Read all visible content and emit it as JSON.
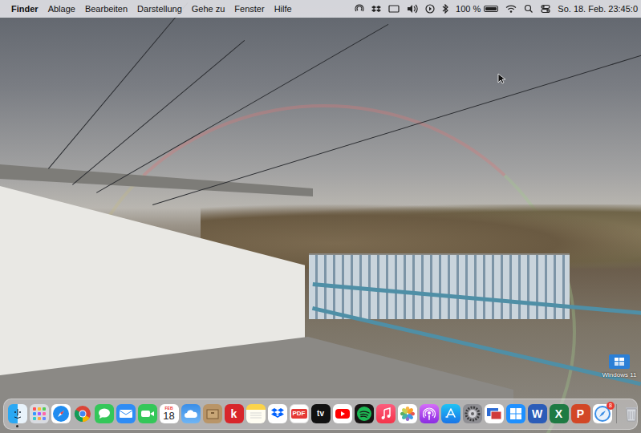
{
  "menubar": {
    "menus": [
      {
        "label": "Finder",
        "selected": true
      },
      {
        "label": "Ablage",
        "selected": false
      },
      {
        "label": "Bearbeiten",
        "selected": false
      },
      {
        "label": "Darstellung",
        "selected": false
      },
      {
        "label": "Gehe zu",
        "selected": false
      },
      {
        "label": "Fenster",
        "selected": false
      },
      {
        "label": "Hilfe",
        "selected": false
      }
    ],
    "status": {
      "battery": "100 %",
      "battery_level": 1,
      "clock": "So. 18. Feb. 23:45:0"
    }
  },
  "desktop": {
    "icons": [
      {
        "label": "Windows 11"
      }
    ]
  },
  "dock": {
    "items": [
      {
        "kind": "finder",
        "running": true
      },
      {
        "kind": "launchpad",
        "running": false
      },
      {
        "kind": "safari",
        "running": false
      },
      {
        "kind": "chrome",
        "running": false
      },
      {
        "kind": "messages",
        "running": false
      },
      {
        "kind": "mail",
        "running": false
      },
      {
        "kind": "facetime",
        "running": false
      },
      {
        "kind": "calendar",
        "running": false,
        "month": "FEB",
        "day": "18"
      },
      {
        "kind": "cloud",
        "running": false
      },
      {
        "kind": "archive",
        "running": false
      },
      {
        "kind": "letter",
        "running": false,
        "label": "k",
        "color": "#d8262b"
      },
      {
        "kind": "notes",
        "running": false
      },
      {
        "kind": "dropbox",
        "running": false
      },
      {
        "kind": "pdf",
        "running": false,
        "label": "PDF"
      },
      {
        "kind": "tv",
        "running": false,
        "label": "tv"
      },
      {
        "kind": "youtube",
        "running": false
      },
      {
        "kind": "spotify",
        "running": false
      },
      {
        "kind": "music",
        "running": false
      },
      {
        "kind": "photos",
        "running": false
      },
      {
        "kind": "podcasts",
        "running": false
      },
      {
        "kind": "appstore",
        "running": false
      },
      {
        "kind": "settings",
        "running": false
      },
      {
        "kind": "remote",
        "running": false
      },
      {
        "kind": "windows",
        "running": false
      },
      {
        "kind": "letter",
        "running": false,
        "label": "W",
        "color": "#2b5cb8"
      },
      {
        "kind": "letter",
        "running": false,
        "label": "X",
        "color": "#1e7a43"
      },
      {
        "kind": "letter",
        "running": false,
        "label": "P",
        "color": "#d24726"
      },
      {
        "kind": "compass",
        "running": false,
        "badge": "8"
      },
      {
        "kind": "trash",
        "running": false
      }
    ]
  }
}
